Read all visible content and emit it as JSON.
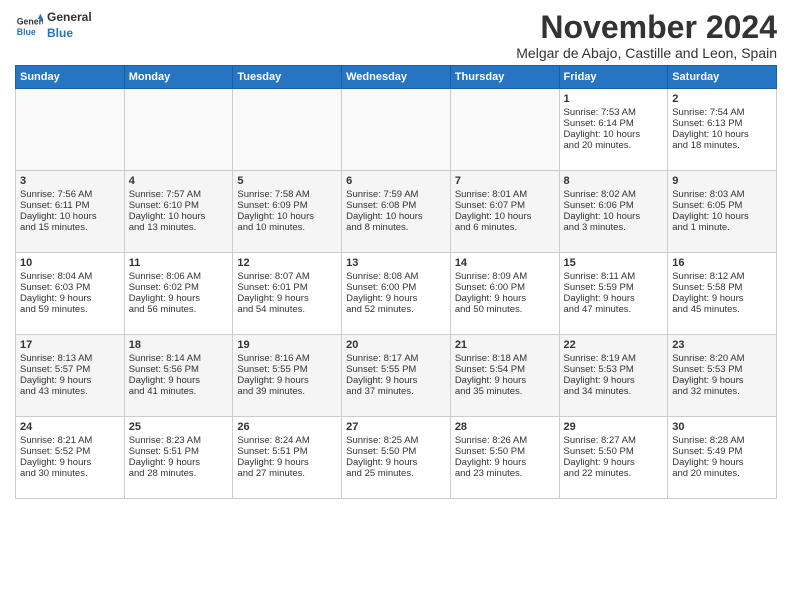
{
  "header": {
    "logo_line1": "General",
    "logo_line2": "Blue",
    "month": "November 2024",
    "location": "Melgar de Abajo, Castille and Leon, Spain"
  },
  "days_of_week": [
    "Sunday",
    "Monday",
    "Tuesday",
    "Wednesday",
    "Thursday",
    "Friday",
    "Saturday"
  ],
  "weeks": [
    [
      {
        "day": "",
        "info": ""
      },
      {
        "day": "",
        "info": ""
      },
      {
        "day": "",
        "info": ""
      },
      {
        "day": "",
        "info": ""
      },
      {
        "day": "",
        "info": ""
      },
      {
        "day": "1",
        "info": "Sunrise: 7:53 AM\nSunset: 6:14 PM\nDaylight: 10 hours\nand 20 minutes."
      },
      {
        "day": "2",
        "info": "Sunrise: 7:54 AM\nSunset: 6:13 PM\nDaylight: 10 hours\nand 18 minutes."
      }
    ],
    [
      {
        "day": "3",
        "info": "Sunrise: 7:56 AM\nSunset: 6:11 PM\nDaylight: 10 hours\nand 15 minutes."
      },
      {
        "day": "4",
        "info": "Sunrise: 7:57 AM\nSunset: 6:10 PM\nDaylight: 10 hours\nand 13 minutes."
      },
      {
        "day": "5",
        "info": "Sunrise: 7:58 AM\nSunset: 6:09 PM\nDaylight: 10 hours\nand 10 minutes."
      },
      {
        "day": "6",
        "info": "Sunrise: 7:59 AM\nSunset: 6:08 PM\nDaylight: 10 hours\nand 8 minutes."
      },
      {
        "day": "7",
        "info": "Sunrise: 8:01 AM\nSunset: 6:07 PM\nDaylight: 10 hours\nand 6 minutes."
      },
      {
        "day": "8",
        "info": "Sunrise: 8:02 AM\nSunset: 6:06 PM\nDaylight: 10 hours\nand 3 minutes."
      },
      {
        "day": "9",
        "info": "Sunrise: 8:03 AM\nSunset: 6:05 PM\nDaylight: 10 hours\nand 1 minute."
      }
    ],
    [
      {
        "day": "10",
        "info": "Sunrise: 8:04 AM\nSunset: 6:03 PM\nDaylight: 9 hours\nand 59 minutes."
      },
      {
        "day": "11",
        "info": "Sunrise: 8:06 AM\nSunset: 6:02 PM\nDaylight: 9 hours\nand 56 minutes."
      },
      {
        "day": "12",
        "info": "Sunrise: 8:07 AM\nSunset: 6:01 PM\nDaylight: 9 hours\nand 54 minutes."
      },
      {
        "day": "13",
        "info": "Sunrise: 8:08 AM\nSunset: 6:00 PM\nDaylight: 9 hours\nand 52 minutes."
      },
      {
        "day": "14",
        "info": "Sunrise: 8:09 AM\nSunset: 6:00 PM\nDaylight: 9 hours\nand 50 minutes."
      },
      {
        "day": "15",
        "info": "Sunrise: 8:11 AM\nSunset: 5:59 PM\nDaylight: 9 hours\nand 47 minutes."
      },
      {
        "day": "16",
        "info": "Sunrise: 8:12 AM\nSunset: 5:58 PM\nDaylight: 9 hours\nand 45 minutes."
      }
    ],
    [
      {
        "day": "17",
        "info": "Sunrise: 8:13 AM\nSunset: 5:57 PM\nDaylight: 9 hours\nand 43 minutes."
      },
      {
        "day": "18",
        "info": "Sunrise: 8:14 AM\nSunset: 5:56 PM\nDaylight: 9 hours\nand 41 minutes."
      },
      {
        "day": "19",
        "info": "Sunrise: 8:16 AM\nSunset: 5:55 PM\nDaylight: 9 hours\nand 39 minutes."
      },
      {
        "day": "20",
        "info": "Sunrise: 8:17 AM\nSunset: 5:55 PM\nDaylight: 9 hours\nand 37 minutes."
      },
      {
        "day": "21",
        "info": "Sunrise: 8:18 AM\nSunset: 5:54 PM\nDaylight: 9 hours\nand 35 minutes."
      },
      {
        "day": "22",
        "info": "Sunrise: 8:19 AM\nSunset: 5:53 PM\nDaylight: 9 hours\nand 34 minutes."
      },
      {
        "day": "23",
        "info": "Sunrise: 8:20 AM\nSunset: 5:53 PM\nDaylight: 9 hours\nand 32 minutes."
      }
    ],
    [
      {
        "day": "24",
        "info": "Sunrise: 8:21 AM\nSunset: 5:52 PM\nDaylight: 9 hours\nand 30 minutes."
      },
      {
        "day": "25",
        "info": "Sunrise: 8:23 AM\nSunset: 5:51 PM\nDaylight: 9 hours\nand 28 minutes."
      },
      {
        "day": "26",
        "info": "Sunrise: 8:24 AM\nSunset: 5:51 PM\nDaylight: 9 hours\nand 27 minutes."
      },
      {
        "day": "27",
        "info": "Sunrise: 8:25 AM\nSunset: 5:50 PM\nDaylight: 9 hours\nand 25 minutes."
      },
      {
        "day": "28",
        "info": "Sunrise: 8:26 AM\nSunset: 5:50 PM\nDaylight: 9 hours\nand 23 minutes."
      },
      {
        "day": "29",
        "info": "Sunrise: 8:27 AM\nSunset: 5:50 PM\nDaylight: 9 hours\nand 22 minutes."
      },
      {
        "day": "30",
        "info": "Sunrise: 8:28 AM\nSunset: 5:49 PM\nDaylight: 9 hours\nand 20 minutes."
      }
    ]
  ]
}
